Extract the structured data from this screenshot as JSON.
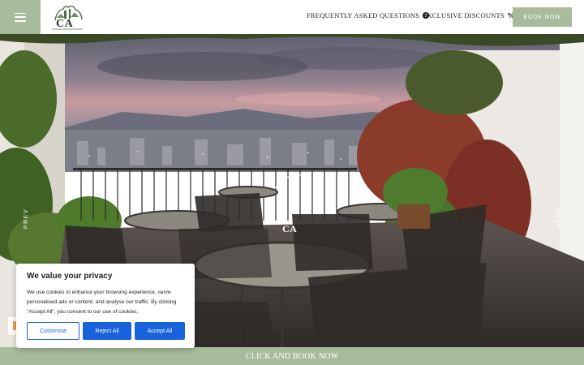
{
  "header": {
    "menu_icon": "hamburger-icon",
    "logo_text": "CA",
    "nav": [
      {
        "label": "FREQUENTLY ASKED QUESTIONS",
        "icon": "question-circle-icon",
        "glyph": "?"
      },
      {
        "label": "EXCLUSIVE DISCOUNTS",
        "icon": "percent-icon",
        "glyph": "%"
      }
    ],
    "book_label": "BOOK NOW"
  },
  "hero": {
    "prev_label": "PREV",
    "next_label": "NEXT",
    "watermark_text": "CA"
  },
  "bottom_bar": {
    "label": "CLICK AND BOOK NOW"
  },
  "cookie": {
    "title": "We value your privacy",
    "body": "We use cookies to enhance your browsing experience, serve personalised ads or content, and analyse our traffic. By clicking \"Accept All\", you consent to our use of cookies.",
    "customise_label": "Customise",
    "reject_label": "Reject All",
    "accept_label": "Accept All"
  },
  "colors": {
    "accent": "#a8bc9b",
    "cookie_button": "#1863dc"
  }
}
